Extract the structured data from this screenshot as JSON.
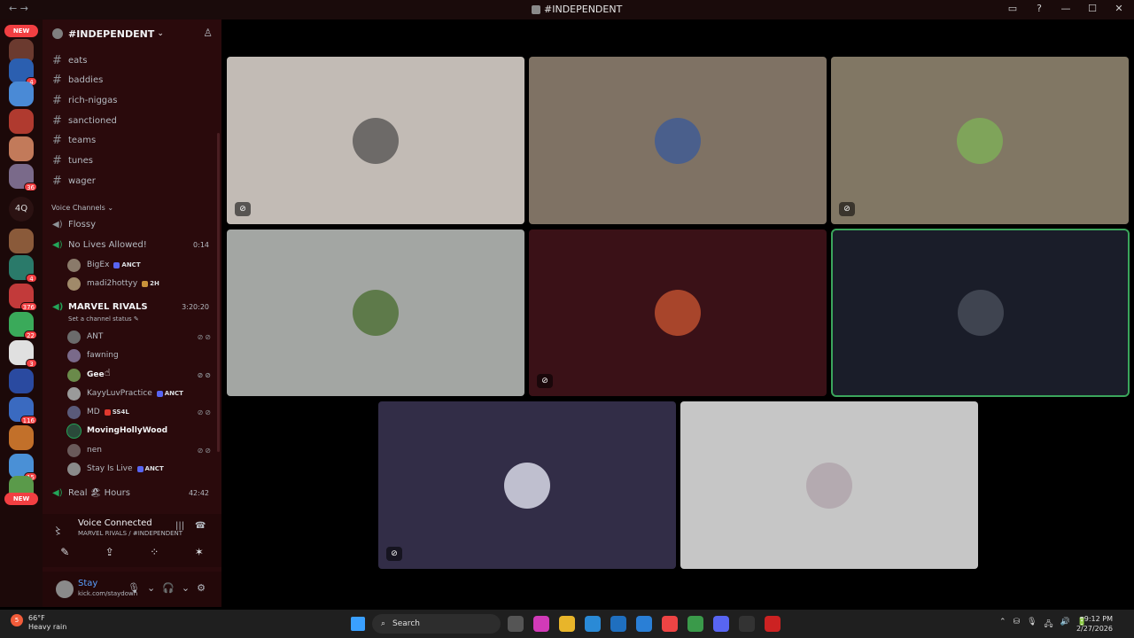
{
  "window": {
    "title": "#INDEPENDENT",
    "nav_label": "← →",
    "controls": [
      "▭",
      "?",
      "—",
      "☐",
      "✕"
    ]
  },
  "guilds": {
    "new_label": "NEW",
    "text_item": "4Q",
    "badges": [
      "4",
      "36",
      "4",
      "376",
      "22",
      "3",
      "116",
      "15"
    ]
  },
  "server": {
    "name": "#INDEPENDENT",
    "chevron": "⌄",
    "invite_icon": "♙"
  },
  "text_channels": [
    "eats",
    "baddies",
    "rich-niggas",
    "sanctioned",
    "teams",
    "tunes",
    "wager"
  ],
  "voice_category": "Voice Channels ⌄",
  "voice_channels": {
    "flossy": {
      "name": "Flossy"
    },
    "no_lives": {
      "name": "No Lives Allowed!",
      "time": "0:14",
      "users": [
        {
          "name": "BigEx",
          "tag": "ANCT"
        },
        {
          "name": "madi2hottyy",
          "tag": "2H"
        }
      ]
    },
    "marvel": {
      "name": "MARVEL RIVALS",
      "time": "3:20:20",
      "status": "Set a channel status ✎",
      "users": [
        {
          "name": "ANT",
          "tag": "",
          "icons": "⊘⊘"
        },
        {
          "name": "fawning",
          "tag": "",
          "icons": ""
        },
        {
          "name": "Gee",
          "tag": "",
          "icons": "⊘⊘"
        },
        {
          "name": "KayyLuvPractice",
          "tag": "ANCT",
          "icons": ""
        },
        {
          "name": "MD",
          "tag": "SS4L",
          "icons": "⊘⊘"
        },
        {
          "name": "MovingHollyWood",
          "tag": "",
          "icons": ""
        },
        {
          "name": "nen",
          "tag": "",
          "icons": "⊘⊘"
        },
        {
          "name": "Stay Is Live",
          "tag": "ANCT",
          "icons": ""
        }
      ]
    },
    "real": {
      "name": "Real 🏖 Hours",
      "time": "42:42"
    }
  },
  "voice_panel": {
    "title": "Voice Connected",
    "subtitle": "MARVEL RIVALS / #INDEPENDENT",
    "buttons": [
      "✎",
      "⇪",
      "⁘",
      "✶"
    ]
  },
  "user": {
    "name": "Stay",
    "status": "kick.com/staydown",
    "controls": [
      "🎙",
      "⌄",
      "🎧",
      "⌄",
      "⚙"
    ]
  },
  "tiles": [
    {
      "bg": "#c2bbb5",
      "avatar": "#6d6a68",
      "no_video": true
    },
    {
      "bg": "#7f7264",
      "avatar": "#4a5f8c",
      "no_video": false
    },
    {
      "bg": "#817764",
      "avatar": "#7fa45a",
      "no_video": true
    },
    {
      "bg": "#a3a6a3",
      "avatar": "#5e7a4a",
      "no_video": false
    },
    {
      "bg": "#3a1117",
      "avatar": "#a8452b",
      "no_video": true
    },
    {
      "bg": "#1a1d29",
      "avatar": "#3f4450",
      "no_video": false,
      "speaking": true
    },
    {
      "bg": "#322d47",
      "avatar": "#bfbfcf",
      "no_video": true
    },
    {
      "bg": "#c6c6c6",
      "avatar": "#b4aab0",
      "no_video": false
    }
  ],
  "no_video_icon": "⊘",
  "taskbar": {
    "weather_temp": "66°F",
    "weather_desc": "Heavy rain",
    "weather_badge": "5",
    "search_label": "Search",
    "search_icon": "⌕",
    "time": "9:12 PM",
    "date": "2/27/2026",
    "tray": [
      "⌃",
      "⛁",
      "🎙",
      "🖧",
      "🔊",
      "🔋"
    ],
    "app_colors": [
      "#555",
      "#d13ab8",
      "#e8b52a",
      "#2a8ad6",
      "#1f6fbf",
      "#2a7fd6",
      "#e44",
      "#3a9a4a",
      "#5865f2",
      "#333",
      "#c22"
    ]
  }
}
